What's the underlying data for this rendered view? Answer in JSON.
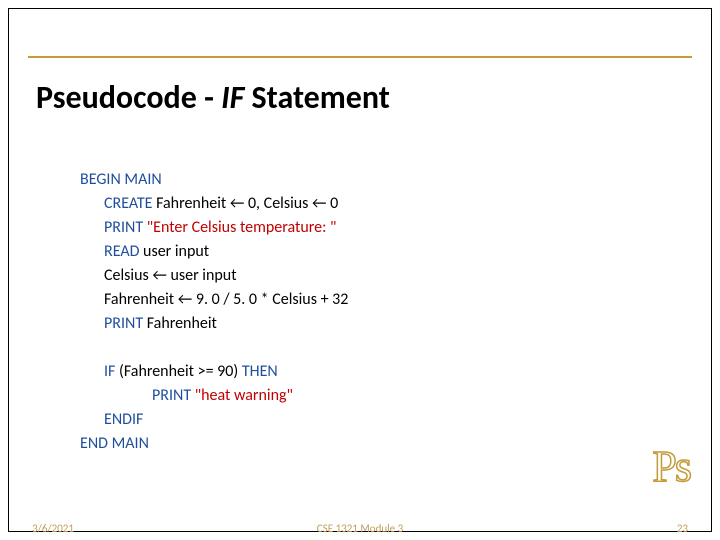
{
  "title_prefix": "Pseudocode - ",
  "title_italic": "IF",
  "title_suffix": " Statement",
  "lines": [
    {
      "cls": "",
      "parts": [
        {
          "t": "BEGIN MAIN",
          "c": "kw"
        }
      ]
    },
    {
      "cls": "indent1",
      "parts": [
        {
          "t": "CREATE ",
          "c": "kw"
        },
        {
          "t": "Fahrenheit ← 0, Celsius ← 0"
        }
      ]
    },
    {
      "cls": "indent1",
      "parts": [
        {
          "t": "PRINT ",
          "c": "kw"
        },
        {
          "t": "\"Enter Celsius temperature: \"",
          "c": "red"
        }
      ]
    },
    {
      "cls": "indent1",
      "parts": [
        {
          "t": "READ ",
          "c": "kw"
        },
        {
          "t": "user input"
        }
      ]
    },
    {
      "cls": "indent1",
      "parts": [
        {
          "t": "Celsius ← user input"
        }
      ]
    },
    {
      "cls": "indent1",
      "parts": [
        {
          "t": "Fahrenheit ← 9. 0 / 5. 0 * Celsius + 32"
        }
      ]
    },
    {
      "cls": "indent1",
      "parts": [
        {
          "t": "PRINT ",
          "c": "kw"
        },
        {
          "t": "Fahrenheit"
        }
      ]
    },
    {
      "cls": "indent1",
      "parts": [
        {
          "t": " "
        }
      ]
    },
    {
      "cls": "indent1",
      "parts": [
        {
          "t": "IF ",
          "c": "kw"
        },
        {
          "t": "(Fahrenheit >= 90) "
        },
        {
          "t": "THEN",
          "c": "kw"
        }
      ]
    },
    {
      "cls": "indent3",
      "parts": [
        {
          "t": "PRINT ",
          "c": "kw"
        },
        {
          "t": "\"heat warning\"",
          "c": "red"
        }
      ]
    },
    {
      "cls": "indent1",
      "parts": [
        {
          "t": "ENDIF",
          "c": "kw"
        }
      ]
    },
    {
      "cls": "",
      "parts": [
        {
          "t": "END MAIN",
          "c": "kw"
        }
      ]
    }
  ],
  "badge": "Ps",
  "footer": {
    "left": "3/6/2021",
    "center": "CSE 1321 Module 3",
    "right": "23"
  }
}
